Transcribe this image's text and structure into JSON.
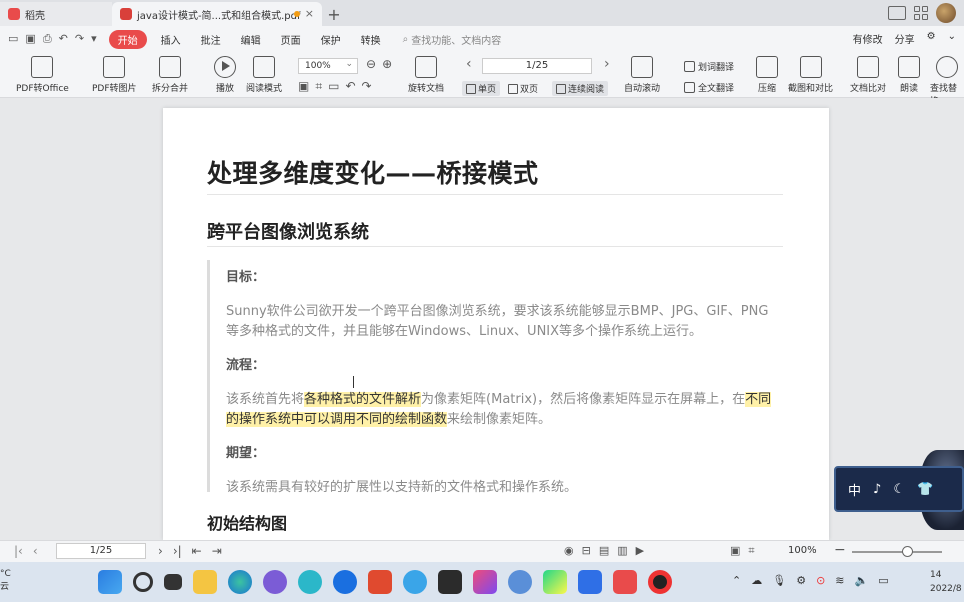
{
  "tabs": {
    "home_label": "稻壳",
    "doc_label": "java设计模式-简...式和组合模式.pdf",
    "new_tab": "+",
    "close": "×"
  },
  "menu": {
    "start": "开始",
    "items": [
      "插入",
      "批注",
      "编辑",
      "页面",
      "保护",
      "转换"
    ],
    "search_placeholder": "查找功能、文档内容",
    "right": [
      "有修改",
      "分享"
    ]
  },
  "ribbon": {
    "pdf_to_office": "PDF转Office",
    "pdf_to_image": "PDF转图片",
    "split_merge": "拆分合并",
    "play": "播放",
    "read_mode": "阅读模式",
    "zoom": "100%",
    "rotate": "旋转文档",
    "page": "1/25",
    "single": "单页",
    "double": "双页",
    "continuous": "连续阅读",
    "auto_scroll": "自动滚动",
    "word_translate": "划词翻译",
    "full_translate": "全文翻译",
    "compress": "压缩",
    "screenshot_compare": "截图和对比",
    "doc_compare": "文档比对",
    "read_aloud": "朗读",
    "find_replace": "查找替换"
  },
  "document": {
    "title": "处理多维度变化——桥接模式",
    "section": "跨平台图像浏览系统",
    "goal_label": "目标：",
    "goal_text": "Sunny软件公司欲开发一个跨平台图像浏览系统，要求该系统能够显示BMP、JPG、GIF、PNG等多种格式的文件，并且能够在Windows、Linux、UNIX等多个操作系统上运行。",
    "flow_label": "流程：",
    "flow_pre": "该系统首先将",
    "flow_hl1": "各种格式的文件解析",
    "flow_mid": "为像素矩阵(Matrix)，然后将像素矩阵显示在屏幕上，在",
    "flow_hl2": "不同的操作系统中可以调用不同的绘制函数",
    "flow_post": "来绘制像素矩阵。",
    "expect_label": "期望：",
    "expect_text": "该系统需具有较好的扩展性以支持新的文件格式和操作系统。",
    "subsection": "初始结构图"
  },
  "widget": {
    "items": [
      "中",
      "♪",
      "☾",
      "👕"
    ]
  },
  "status": {
    "page": "1/25",
    "zoom": "100%"
  },
  "taskbar": {
    "weather_temp": "°C",
    "weather_desc": "云",
    "clock_time": "14",
    "clock_date": "2022/8"
  },
  "colors": {
    "accent": "#e94b4b",
    "highlight": "#fff1a8",
    "widget_bg": "#1b2a4a"
  }
}
